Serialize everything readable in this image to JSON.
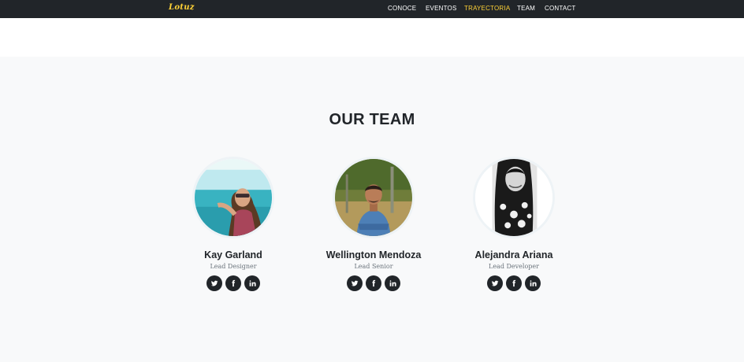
{
  "navbar": {
    "brand": "Lotuz",
    "links": [
      "CONOCE",
      "EVENTOS",
      "TRAYECTORIA",
      "TEAM",
      "CONTACT"
    ],
    "active_link": "TRAYECTORIA",
    "accent_color": "#fed136",
    "background_color": "#212529"
  },
  "team": {
    "title": "OUR TEAM",
    "members": [
      {
        "name": "Kay Garland",
        "role": "Lead Designer",
        "socials": [
          "twitter-icon",
          "facebook-icon",
          "linkedin-icon"
        ]
      },
      {
        "name": "Wellington Mendoza",
        "role": "Lead Senior",
        "socials": [
          "twitter-icon",
          "facebook-icon",
          "linkedin-icon"
        ]
      },
      {
        "name": "Alejandra Ariana",
        "role": "Lead Developer",
        "socials": [
          "twitter-icon",
          "facebook-icon",
          "linkedin-icon"
        ]
      }
    ]
  }
}
